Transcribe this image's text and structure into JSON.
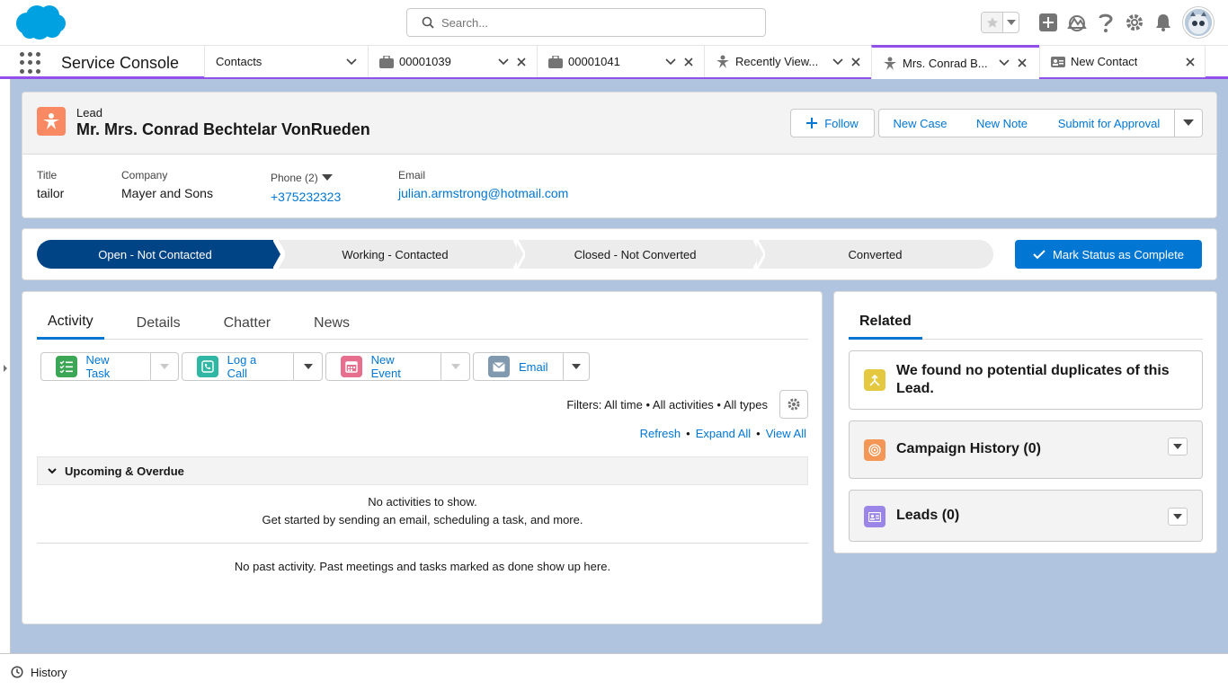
{
  "topbar": {
    "search_placeholder": "Search..."
  },
  "nav": {
    "app_name": "Service Console",
    "tabs": [
      {
        "label": "Contacts"
      },
      {
        "label": "00001039"
      },
      {
        "label": "00001041"
      },
      {
        "label": "Recently View..."
      },
      {
        "label": "Mrs. Conrad B..."
      },
      {
        "label": "New Contact"
      }
    ]
  },
  "record": {
    "object_type": "Lead",
    "name": "Mr. Mrs. Conrad Bechtelar VonRueden",
    "actions": {
      "follow": "Follow",
      "new_case": "New Case",
      "new_note": "New Note",
      "submit": "Submit for Approval"
    },
    "fields": {
      "title_label": "Title",
      "title_value": "tailor",
      "company_label": "Company",
      "company_value": "Mayer and Sons",
      "phone_label": "Phone (2)",
      "phone_value": "+375232323",
      "email_label": "Email",
      "email_value": "julian.armstrong@hotmail.com"
    }
  },
  "path": {
    "steps": [
      "Open - Not Contacted",
      "Working - Contacted",
      "Closed - Not Converted",
      "Converted"
    ],
    "current_step": 0,
    "mark_complete": "Mark Status as Complete"
  },
  "activity": {
    "tabs": [
      "Activity",
      "Details",
      "Chatter",
      "News"
    ],
    "publishers": {
      "new_task": "New Task",
      "log_call": "Log a Call",
      "new_event": "New Event",
      "email": "Email"
    },
    "filters": "Filters: All time • All activities • All types",
    "refresh": "Refresh",
    "expand_all": "Expand All",
    "view_all": "View All",
    "separator": "•",
    "upcoming_title": "Upcoming & Overdue",
    "no_activities": "No activities to show.",
    "get_started": "Get started by sending an email, scheduling a task, and more.",
    "no_past": "No past activity. Past meetings and tasks marked as done show up here."
  },
  "related": {
    "tab": "Related",
    "duplicates": "We found no potential duplicates of this Lead.",
    "campaign_history": "Campaign History (0)",
    "leads": "Leads (0)"
  },
  "footer": {
    "history": "History"
  },
  "colors": {
    "brand_blue": "#0176d3",
    "path_active": "#014486",
    "nav_accent": "#9050e9",
    "lead_orange": "#f88962"
  }
}
